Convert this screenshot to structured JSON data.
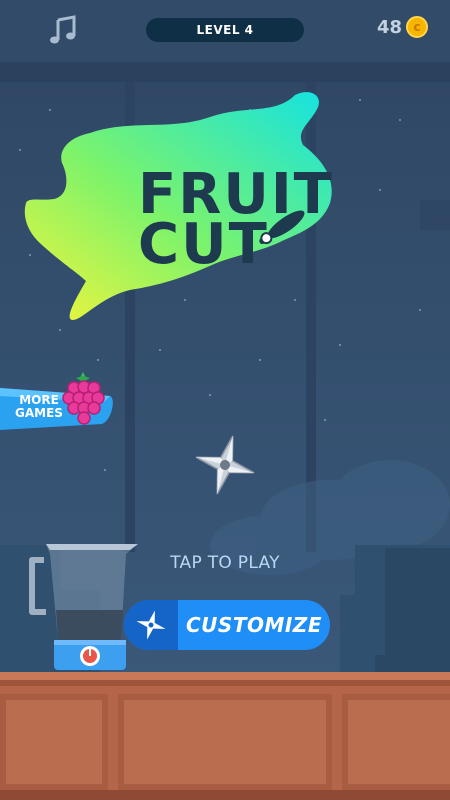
{
  "header": {
    "level_label": "LEVEL 4",
    "coins": "48",
    "coin_symbol": "c"
  },
  "logo": {
    "line1": "FRUIT",
    "line2": "CUT"
  },
  "more_games": {
    "label_line1": "MORE",
    "label_line2": "GAMES"
  },
  "main": {
    "tap_to_play": "TAP TO PLAY",
    "customize_label": "CUSTOMIZE"
  },
  "colors": {
    "sky_top": "#2e4663",
    "sky_bottom": "#3b5a7b",
    "table": "#b5664a",
    "button_blue": "#1f8ef7",
    "logo_gradient_start": "#f4f33a",
    "logo_gradient_end": "#16e5e0",
    "logo_text": "#1d3a4f"
  },
  "icons": {
    "music": "music-note-icon",
    "coin": "coin-icon",
    "raspberry": "raspberry-icon",
    "shuriken": "shuriken-icon",
    "blender": "blender-icon",
    "knife": "knife-icon"
  }
}
